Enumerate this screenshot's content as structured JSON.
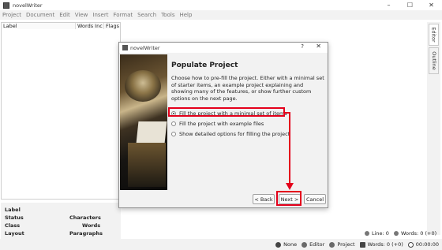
{
  "window": {
    "title": "novelWriter",
    "controls": [
      "–",
      "☐",
      "✕"
    ]
  },
  "menu": [
    "Project",
    "Document",
    "Edit",
    "View",
    "Insert",
    "Format",
    "Search",
    "Tools",
    "Help"
  ],
  "tree": {
    "columns": [
      "Label",
      "Words Inc",
      "Flags"
    ]
  },
  "details": {
    "label": "Label",
    "status": "Status",
    "class": "Class",
    "layout": "Layout",
    "characters": "Characters",
    "words": "Words",
    "paragraphs": "Paragraphs"
  },
  "side_tabs": [
    "Editor",
    "Outline"
  ],
  "line_info": {
    "line": "Line: 0",
    "words": "Words: 0 (+0)"
  },
  "status": {
    "none": "None",
    "editor": "Editor",
    "project": "Project",
    "words": "Words: 0 (+0)",
    "time": "00:00:00"
  },
  "dialog": {
    "title": "novelWriter",
    "help": "?",
    "close": "✕",
    "heading": "Populate Project",
    "description": "Choose how to pre-fill the project. Either with a minimal set of starter items, an example project explaining and showing many of the features, or show further custom options on the next page.",
    "options": [
      {
        "label": "Fill the project with a minimal set of items",
        "checked": true
      },
      {
        "label": "Fill the project with example files",
        "checked": false
      },
      {
        "label": "Show detailed options for filling the project",
        "checked": false
      }
    ],
    "buttons": {
      "back": "< Back",
      "next": "Next >",
      "cancel": "Cancel"
    }
  },
  "colors": {
    "highlight": "#e4001b"
  }
}
